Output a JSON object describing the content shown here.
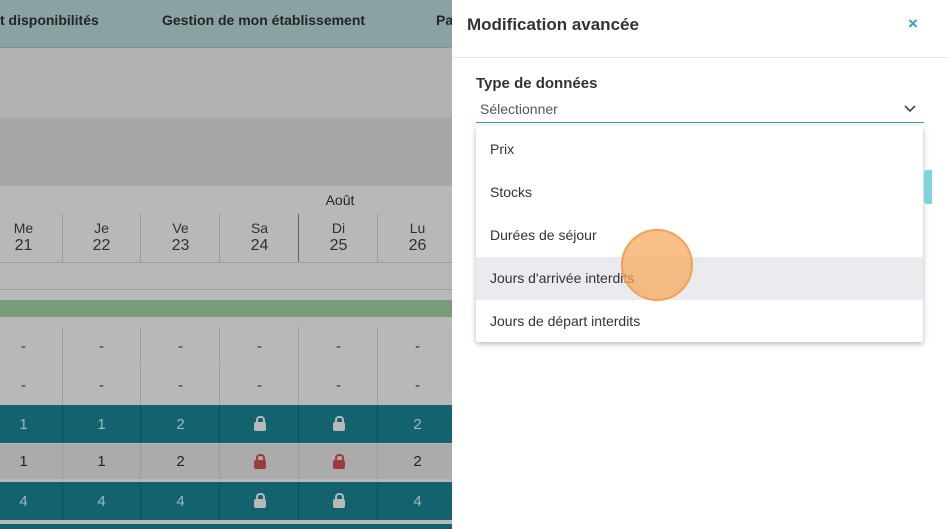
{
  "nav": {
    "item1": "t disponibilités",
    "item2": "Gestion de mon établissement",
    "item3": "Pa"
  },
  "calendar": {
    "month": "Août",
    "days": [
      {
        "name": "Me",
        "num": "21"
      },
      {
        "name": "Je",
        "num": "22"
      },
      {
        "name": "Ve",
        "num": "23"
      },
      {
        "name": "Sa",
        "num": "24"
      },
      {
        "name": "Di",
        "num": "25"
      },
      {
        "name": "Lu",
        "num": "26"
      }
    ],
    "rows": [
      {
        "style": "light",
        "cells": [
          "-",
          "-",
          "-",
          "-",
          "-",
          "-"
        ]
      },
      {
        "style": "light",
        "cells": [
          "-",
          "-",
          "-",
          "-",
          "-",
          "-"
        ]
      },
      {
        "style": "teal",
        "cells": [
          "1",
          "1",
          "2",
          "lock",
          "lock",
          "2"
        ]
      },
      {
        "style": "grey",
        "cells": [
          "1",
          "1",
          "2",
          "lock-red",
          "lock-red",
          "2"
        ]
      },
      {
        "style": "teal",
        "cells": [
          "4",
          "4",
          "4",
          "lock",
          "lock",
          "4"
        ]
      }
    ]
  },
  "panel": {
    "title": "Modification avancée",
    "close": "×",
    "field_label": "Type de données",
    "select_value": "Sélectionner",
    "options": [
      "Prix",
      "Stocks",
      "Durées de séjour",
      "Jours d'arrivée interdits",
      "Jours de départ interdits"
    ],
    "hovered_option": "Jours d'arrivée interdits"
  },
  "colors": {
    "accent": "#2aa7b7",
    "teal_row": "#1a8a99",
    "click_marker": "#f7a65a"
  }
}
